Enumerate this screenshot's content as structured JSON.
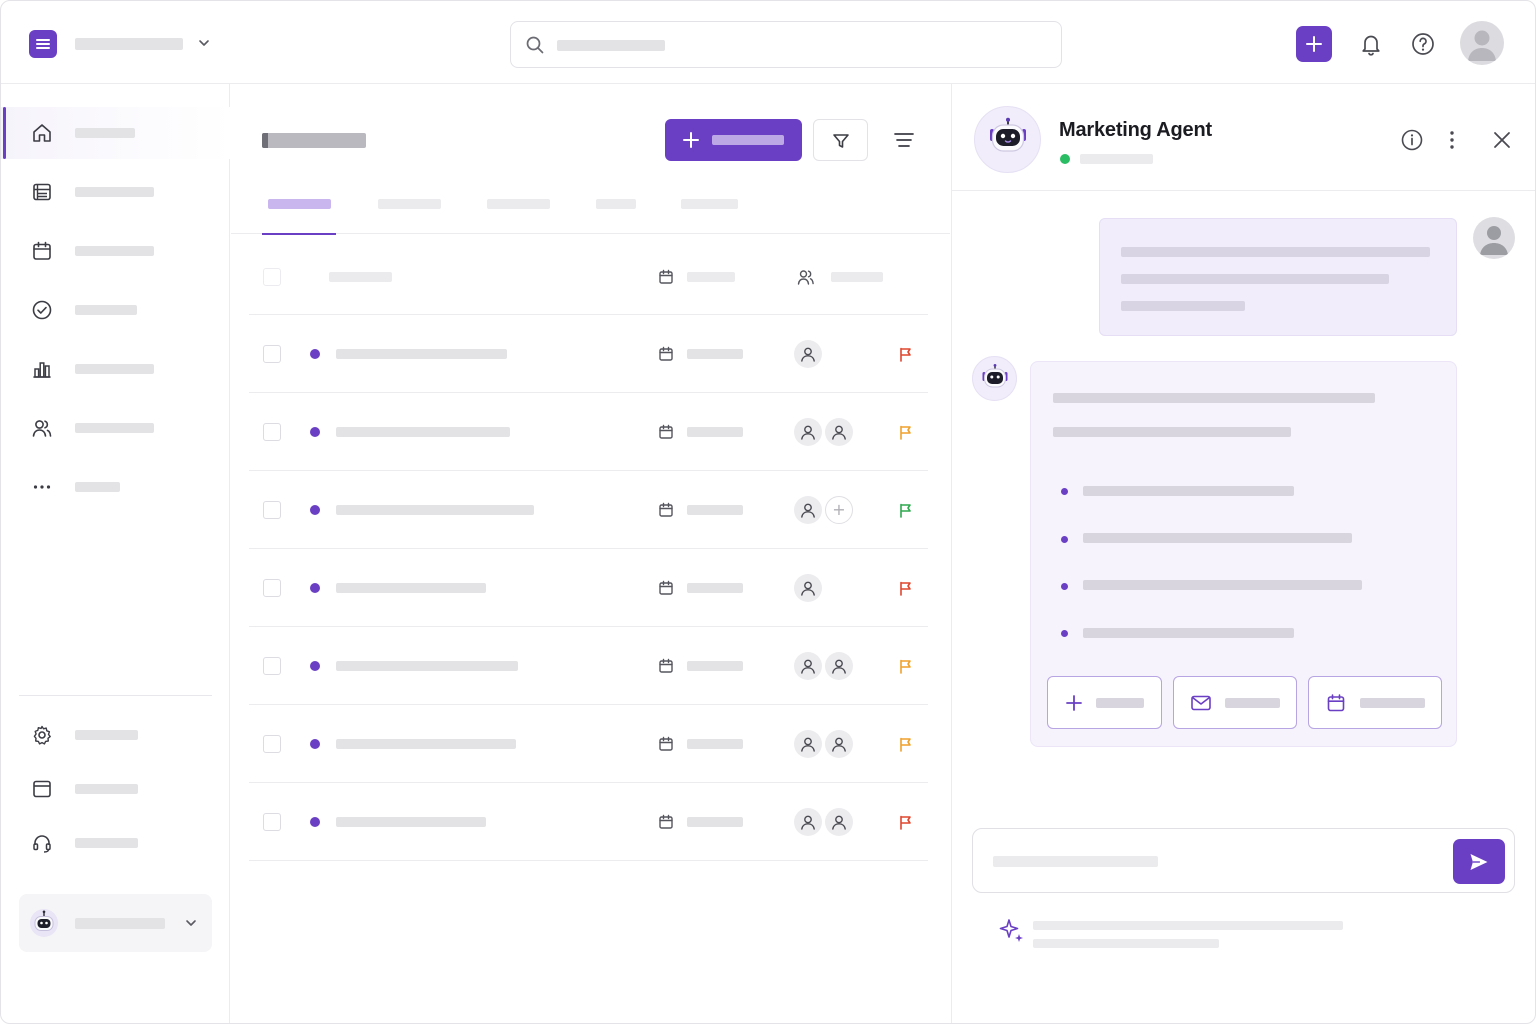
{
  "chat": {
    "agent_name": "Marketing Agent",
    "status_color": "#2bbd63"
  },
  "theme": {
    "accent": "#6a3fc4",
    "flag_colors": {
      "red": "#e0462f",
      "orange": "#f0a12c",
      "green": "#2fa94f"
    }
  },
  "icons": {
    "topbar": [
      "menu-icon",
      "chevron-down-icon",
      "search-icon",
      "plus-icon",
      "bell-icon",
      "help-icon",
      "user-icon"
    ],
    "sidebar_nav": [
      "home-icon",
      "list-icon",
      "calendar-icon",
      "check-circle-icon",
      "bar-chart-icon",
      "users-icon",
      "more-icon"
    ],
    "sidebar_footer": [
      "gear-icon",
      "window-icon",
      "headset-icon"
    ],
    "toolbar": [
      "plus-icon",
      "filter-icon",
      "sort-icon"
    ],
    "chat_header": [
      "info-icon",
      "kebab-icon",
      "close-icon"
    ],
    "chat_actions": [
      "plus-icon",
      "mail-icon",
      "calendar-icon"
    ],
    "composer": [
      "send-icon",
      "sparkle-icon"
    ]
  },
  "table": {
    "rows": [
      {
        "assignees": 1,
        "add_assignee": false,
        "priority": "red"
      },
      {
        "assignees": 2,
        "add_assignee": false,
        "priority": "orange"
      },
      {
        "assignees": 1,
        "add_assignee": true,
        "priority": "green"
      },
      {
        "assignees": 1,
        "add_assignee": false,
        "priority": "red"
      },
      {
        "assignees": 2,
        "add_assignee": false,
        "priority": "orange"
      },
      {
        "assignees": 2,
        "add_assignee": false,
        "priority": "orange"
      },
      {
        "assignees": 2,
        "add_assignee": false,
        "priority": "red"
      }
    ]
  }
}
